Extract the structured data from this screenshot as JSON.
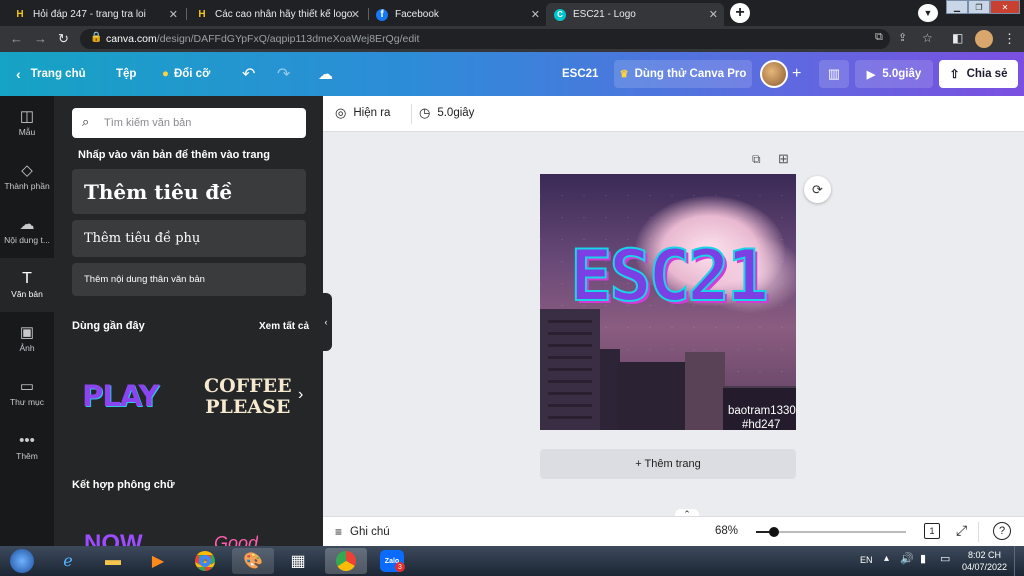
{
  "browser": {
    "tabs": [
      {
        "title": "Hỏi đáp 247 - trang tra loi",
        "favicon": "H"
      },
      {
        "title": "Các cao nhân hãy thiết kế logo E",
        "favicon": "H"
      },
      {
        "title": "Facebook",
        "favicon": "f"
      },
      {
        "title": "ESC21 - Logo",
        "favicon": "C",
        "active": true
      }
    ],
    "url_domain": "canva.com",
    "url_path": "/design/DAFFdGYpFxQ/aqpip113dmeXoaWej8ErQg/edit"
  },
  "topbar": {
    "home": "Trang chủ",
    "file": "Tệp",
    "resize": "Đổi cỡ",
    "design_name": "ESC21",
    "try_pro": "Dùng thử Canva Pro",
    "play_time": "5.0giây",
    "share": "Chia sẻ"
  },
  "rail": [
    {
      "label": "Mẫu",
      "icon": "layout-icon"
    },
    {
      "label": "Thành phần",
      "icon": "shapes-icon"
    },
    {
      "label": "Nội dung t...",
      "icon": "upload-cloud-icon"
    },
    {
      "label": "Văn bản",
      "icon": "text-icon",
      "selected": true
    },
    {
      "label": "Ảnh",
      "icon": "image-icon"
    },
    {
      "label": "Thư mục",
      "icon": "folder-icon"
    },
    {
      "label": "Thêm",
      "icon": "more-icon"
    }
  ],
  "panel": {
    "search_placeholder": "Tìm kiếm văn bản",
    "hint": "Nhấp vào văn bản để thêm vào trang",
    "add_heading": "Thêm tiêu đề",
    "add_subheading": "Thêm tiêu đề phụ",
    "add_body": "Thêm nội dung thân văn bản",
    "recent_title": "Dùng gần đây",
    "see_all": "Xem tất cả",
    "recent_items": [
      "PLAY",
      "COFFEE",
      "PLEASE"
    ],
    "combo_title": "Kết hợp phông chữ",
    "combo_items": [
      "NOW",
      "Good"
    ]
  },
  "canvas_toolbar": {
    "animate": "Hiện ra",
    "duration": "5.0giây"
  },
  "design": {
    "logo_text": "ESC21",
    "credit_line1": "baotram1330",
    "credit_line2": "#hd247",
    "logo_color": "#7b3fe4",
    "logo_outline": "#19d3e6"
  },
  "add_page": "+ Thêm trang",
  "bottom": {
    "notes": "Ghi chú",
    "zoom": "68%",
    "page_num": "1",
    "zoom_level": 0.68
  },
  "taskbar": {
    "lang": "EN",
    "time": "8:02 CH",
    "date": "04/07/2022",
    "zalo": "Zalo",
    "zalo_badge": "3"
  }
}
